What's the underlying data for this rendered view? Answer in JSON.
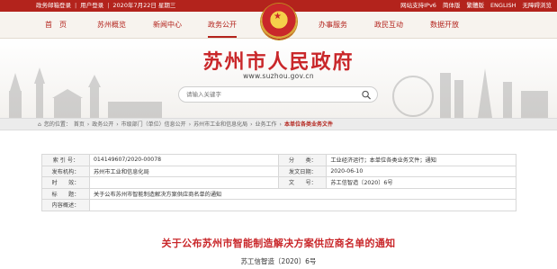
{
  "topbar": {
    "left_links": [
      "政务邮箱登录",
      "用户登录",
      "2020年7月22日 星期三"
    ],
    "right_links": [
      "网站支持IPv6",
      "简体版",
      "繁體版",
      "ENGLISH",
      "无障碍浏览"
    ]
  },
  "nav": {
    "items": [
      "首　页",
      "苏州概览",
      "新闻中心",
      "政务公开",
      "办事服务",
      "政民互动",
      "数据开放"
    ],
    "active": "政务公开"
  },
  "header": {
    "site_title": "苏州市人民政府",
    "site_url": "www.suzhou.gov.cn",
    "search_placeholder": "请输入关键字"
  },
  "breadcrumb": {
    "label": "您的位置：",
    "path": [
      "首页",
      "政务公开",
      "市级部门（单位）信息公开",
      "苏州市工业和信息化局",
      "业务工作"
    ],
    "current": "本单位各类业务文件",
    "separator": "›"
  },
  "meta": {
    "index_label": "索 引 号：",
    "index_value": "014149607/2020-00078",
    "category_label": "分　　类：",
    "category_value": "工业经济运行；本单位各类业务文件；通知",
    "issuer_label": "发布机构：",
    "issuer_value": "苏州市工业和信息化局",
    "date_label": "发文日期：",
    "date_value": "2020-06-10",
    "validity_label": "时　　效：",
    "validity_value": "",
    "docno_label": "文　　号：",
    "docno_value": "苏工信智造〔2020〕6号",
    "title_label": "标　　题：",
    "title_value": "关于公布苏州市智能制造解决方案供应商名单的通知",
    "summary_label": "内容概述：",
    "summary_value": ""
  },
  "document": {
    "title": "关于公布苏州市智能制造解决方案供应商名单的通知",
    "number": "苏工信智造〔2020〕6号"
  },
  "colors": {
    "brand_red": "#b3231c",
    "title_red": "#c9272a"
  }
}
